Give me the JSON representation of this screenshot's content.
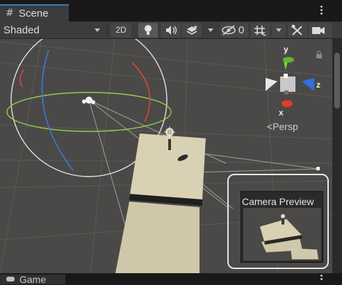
{
  "tab": {
    "label": "Scene",
    "icon": "hashtag-grid-icon"
  },
  "toolbar": {
    "draw_mode": "Shaded",
    "mode_2d": "2D",
    "hidden_count": "0",
    "icons": [
      "lightbulb-icon",
      "audio-icon",
      "effects-layers-icon",
      "eye-slash-icon",
      "grid-icon",
      "tools-icon",
      "camera-icon"
    ]
  },
  "scene": {
    "gizmo": {
      "x": "x",
      "y": "y",
      "z": "z",
      "projection": "Persp"
    },
    "camera_preview": {
      "title": "Camera Preview"
    }
  },
  "bottom_tab": {
    "label": "Game"
  },
  "colors": {
    "tab_accent": "#3a79bb",
    "scene_bg": "#4b4947",
    "axis_x": "#e5322b",
    "axis_y": "#7bd334",
    "axis_z": "#2f6fe0",
    "plane": "#d9d1b4"
  }
}
